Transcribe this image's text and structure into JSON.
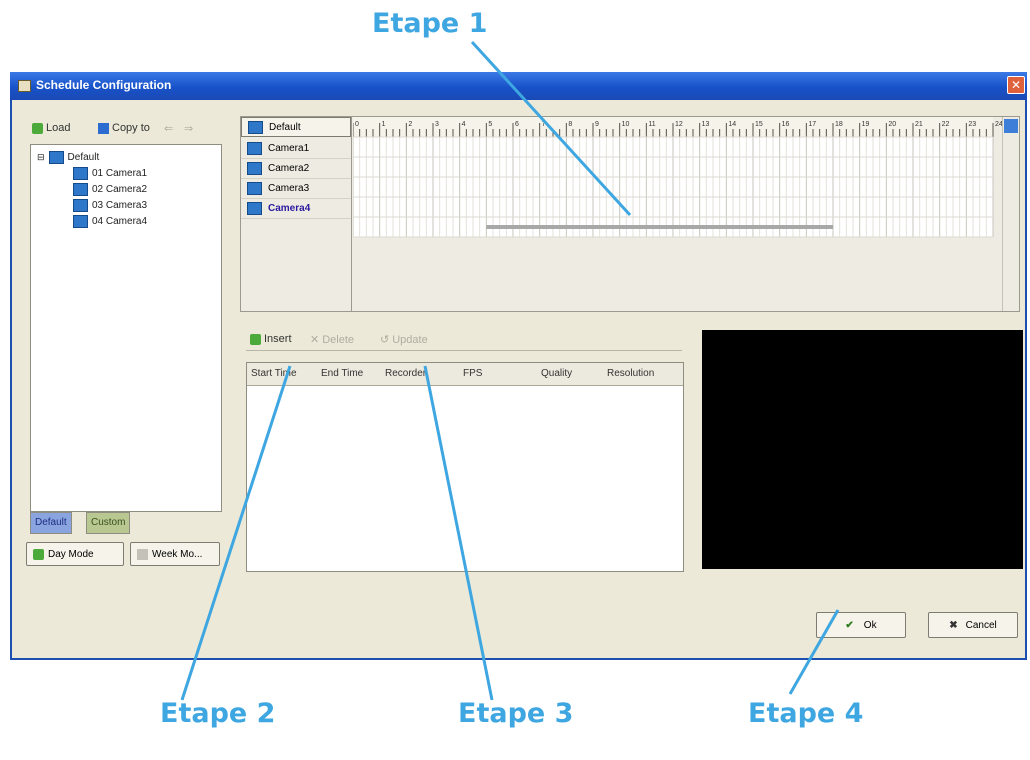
{
  "callouts": {
    "etape1": "Etape 1",
    "etape2": "Etape 2",
    "etape3": "Etape 3",
    "etape4": "Etape 4",
    "color": "#3ea6e0"
  },
  "window": {
    "title": "Schedule Configuration",
    "title_color": "#1852c9",
    "close": "✕"
  },
  "left_panel": {
    "toolbar": {
      "load": "Load",
      "copy_to": "Copy to"
    },
    "tree": {
      "root": "Default",
      "items": [
        "01 Camera1",
        "02 Camera2",
        "03 Camera3",
        "04 Camera4"
      ]
    },
    "tabs": [
      "Default",
      "Custom"
    ],
    "buttons": {
      "day_mode": "Day Mode",
      "week_mode": "Week Mo..."
    }
  },
  "schedule": {
    "rows": [
      "Default",
      "Camera1",
      "Camera2",
      "Camera3",
      "Camera4"
    ],
    "selected_row": "Camera4",
    "hour_labels": [
      "0",
      "1",
      "2",
      "3",
      "4",
      "5",
      "6",
      "7",
      "8",
      "9",
      "10",
      "11",
      "12",
      "13",
      "14",
      "15",
      "16",
      "17",
      "18",
      "19",
      "20",
      "21",
      "22",
      "23",
      "24"
    ],
    "selected_range_hours": [
      5,
      18
    ]
  },
  "records": {
    "toolbar": {
      "insert": "Insert",
      "delete": "Delete",
      "update": "Update"
    },
    "columns": [
      "Start Time",
      "End Time",
      "Recorder",
      "FPS",
      "Quality",
      "Resolution"
    ]
  },
  "footer": {
    "ok": "Ok",
    "cancel": "Cancel"
  }
}
